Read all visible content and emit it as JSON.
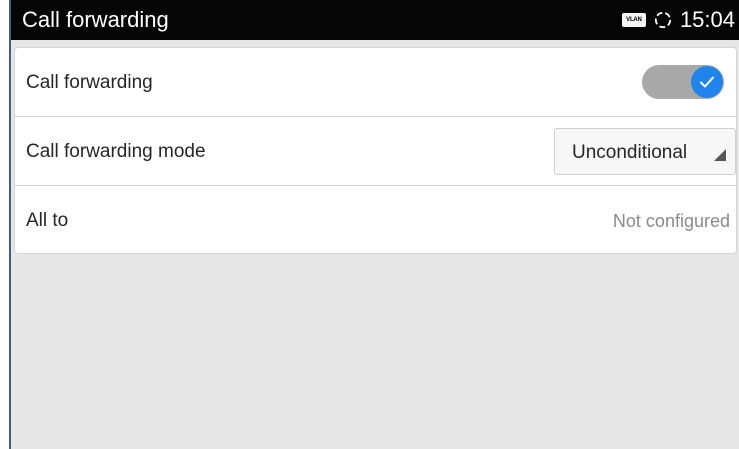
{
  "status_bar": {
    "title": "Call forwarding",
    "vlan_badge": "VLAN",
    "sync_icon": "sync-icon",
    "time": "15:04"
  },
  "settings": {
    "call_forwarding": {
      "label": "Call forwarding",
      "enabled": true,
      "toggle_color": "#1f84eb"
    },
    "mode": {
      "label": "Call forwarding mode",
      "selected": "Unconditional"
    },
    "all_to": {
      "label": "All to",
      "value": "Not configured"
    }
  }
}
